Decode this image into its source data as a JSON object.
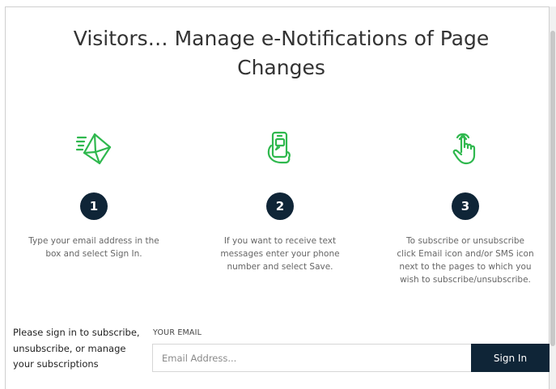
{
  "header": {
    "title": "Visitors… Manage e-Notifications of Page Changes"
  },
  "steps": [
    {
      "icon": "envelope-send-icon",
      "number": "1",
      "text": "Type your email address in the box and select Sign In."
    },
    {
      "icon": "phone-text-icon",
      "number": "2",
      "text": "If you want to receive text messages enter your phone number and select Save."
    },
    {
      "icon": "hand-tap-icon",
      "number": "3",
      "text": "To subscribe or unsubscribe click Email icon and/or SMS icon next to the pages to which you wish to subscribe/unsubscribe."
    }
  ],
  "signin": {
    "note": "Please sign in to subscribe, unsubscribe, or manage your subscriptions",
    "email_label": "YOUR EMAIL",
    "email_placeholder": "Email Address...",
    "email_value": "",
    "button_label": "Sign In"
  },
  "colors": {
    "accent_green": "#2fb84e",
    "navy": "#0f2537"
  }
}
